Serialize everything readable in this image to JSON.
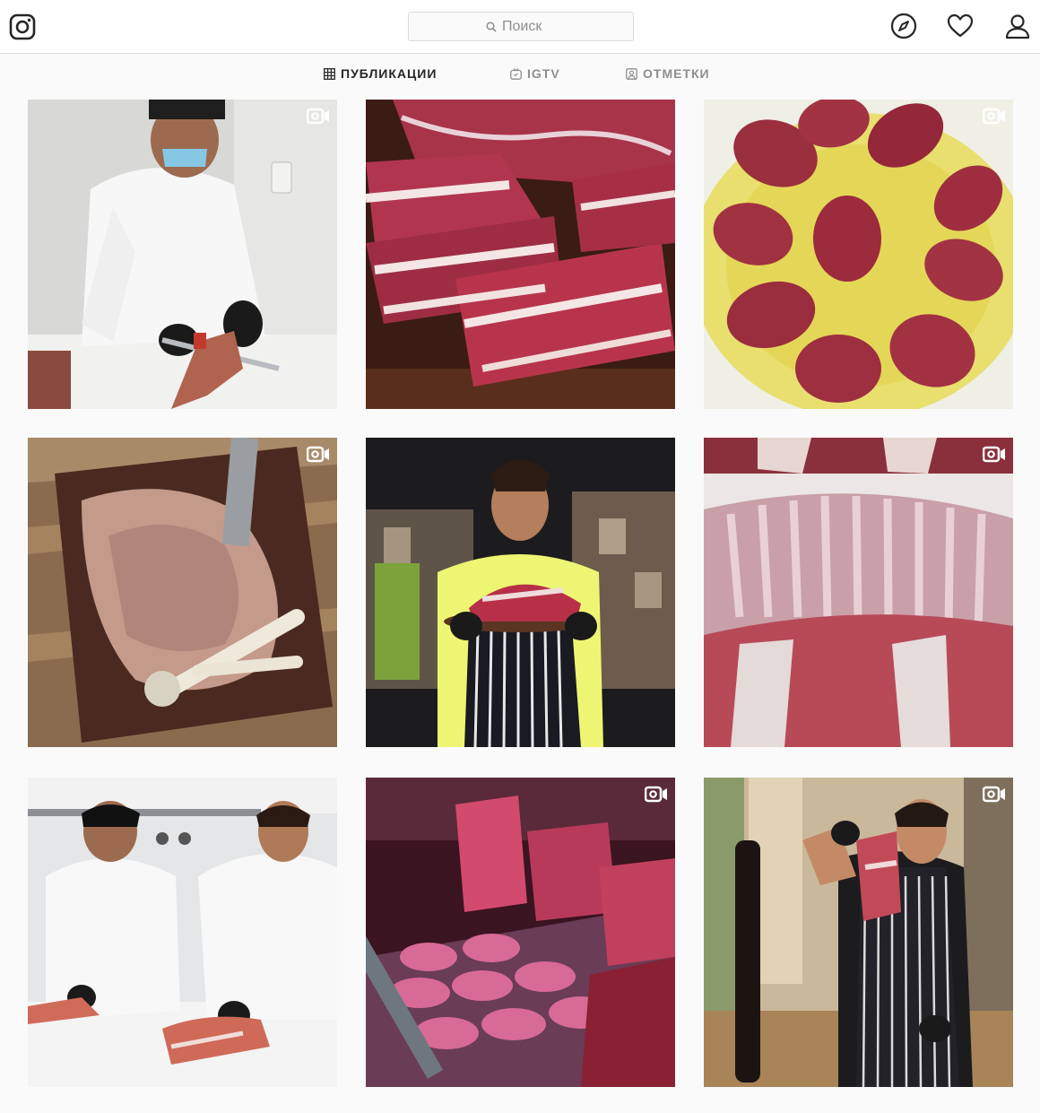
{
  "header": {
    "search_placeholder": "Поиск",
    "logo_icon": "instagram-logo-icon",
    "nav_icons": [
      "compass-icon",
      "heart-icon",
      "profile-icon"
    ]
  },
  "tabs": [
    {
      "label": "ПУБЛИКАЦИИ",
      "icon": "grid-icon",
      "active": true
    },
    {
      "label": "IGTV",
      "icon": "igtv-icon",
      "active": false
    },
    {
      "label": "ОТМЕТКИ",
      "icon": "tagged-icon",
      "active": false
    }
  ],
  "posts": [
    {
      "subject": "butcher in white coat cutting meat",
      "video": true
    },
    {
      "subject": "raw ribeye steaks on board",
      "video": false
    },
    {
      "subject": "tenderloin medallions in oil",
      "video": true
    },
    {
      "subject": "seasoned lamb with bones on board",
      "video": true
    },
    {
      "subject": "chef in apron holding steaks",
      "video": false
    },
    {
      "subject": "raw lamb rack ribs",
      "video": true
    },
    {
      "subject": "two butchers cutting lamb",
      "video": false
    },
    {
      "subject": "meat display case with patties",
      "video": true
    },
    {
      "subject": "chef holding raw steak with pepper mill",
      "video": true
    }
  ],
  "colors": {
    "background": "#fafafa",
    "border": "#dbdbdb",
    "text": "#262626",
    "muted": "#8e8e8e"
  }
}
